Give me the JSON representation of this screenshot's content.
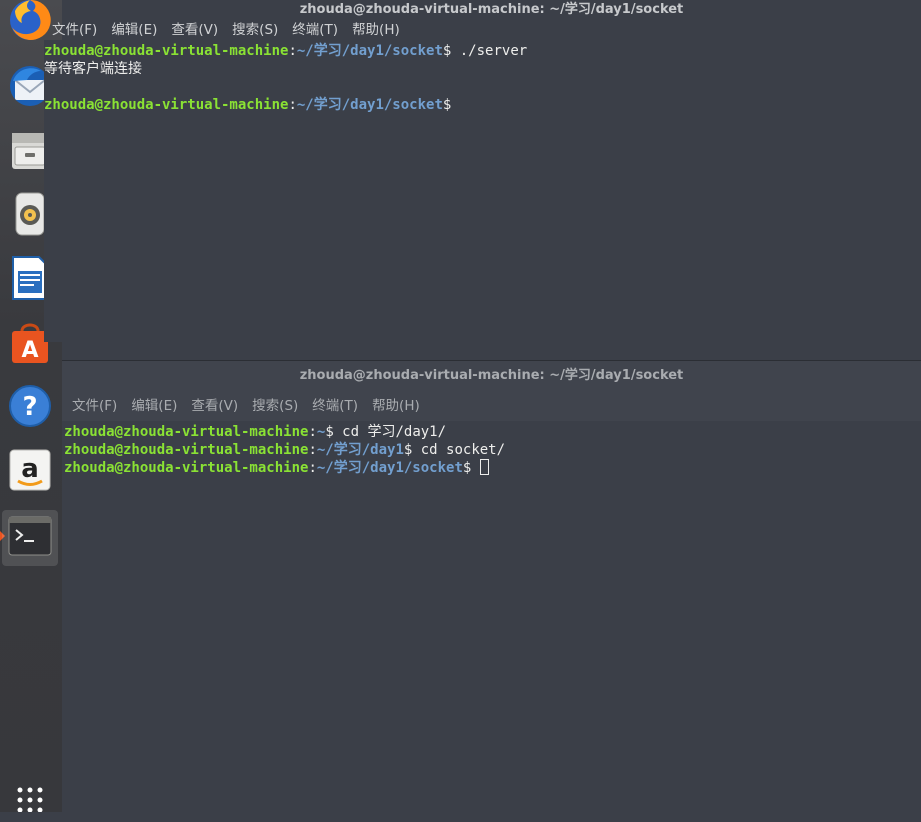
{
  "dock": {
    "items": [
      {
        "name": "firefox-icon"
      },
      {
        "name": "thunderbird-icon"
      },
      {
        "name": "files-icon"
      },
      {
        "name": "rhythmbox-icon"
      },
      {
        "name": "libreoffice-writer-icon"
      },
      {
        "name": "software-center-icon"
      },
      {
        "name": "help-icon"
      },
      {
        "name": "amazon-icon"
      },
      {
        "name": "terminal-icon"
      }
    ],
    "apps_grid": "show-applications-icon"
  },
  "terminal_top": {
    "title": "zhouda@zhouda-virtual-machine: ~/学习/day1/socket",
    "menu": [
      "文件(F)",
      "编辑(E)",
      "查看(V)",
      "搜索(S)",
      "终端(T)",
      "帮助(H)"
    ],
    "lines": [
      {
        "user": "zhouda@zhouda-virtual-machine",
        "sep": ":",
        "path": "~/学习/day1/socket",
        "prompt": "$ ",
        "cmd": "./server"
      },
      {
        "output": "等待客户端连接"
      },
      {
        "output": ""
      },
      {
        "user": "zhouda@zhouda-virtual-machine",
        "sep": ":",
        "path": "~/学习/day1/socket",
        "prompt": "$",
        "cmd": ""
      }
    ]
  },
  "terminal_bottom": {
    "title": "zhouda@zhouda-virtual-machine: ~/学习/day1/socket",
    "menu": [
      "文件(F)",
      "编辑(E)",
      "查看(V)",
      "搜索(S)",
      "终端(T)",
      "帮助(H)"
    ],
    "lines": [
      {
        "user": "zhouda@zhouda-virtual-machine",
        "sep": ":",
        "path": "~",
        "prompt": "$ ",
        "cmd": "cd 学习/day1/"
      },
      {
        "user": "zhouda@zhouda-virtual-machine",
        "sep": ":",
        "path": "~/学习/day1",
        "prompt": "$ ",
        "cmd": "cd socket/"
      },
      {
        "user": "zhouda@zhouda-virtual-machine",
        "sep": ":",
        "path": "~/学习/day1/socket",
        "prompt": "$ ",
        "cmd": ""
      }
    ]
  },
  "colors": {
    "user": "#8ae234",
    "path": "#729fcf",
    "accent": "#e95420",
    "background": "#3b3f48"
  }
}
